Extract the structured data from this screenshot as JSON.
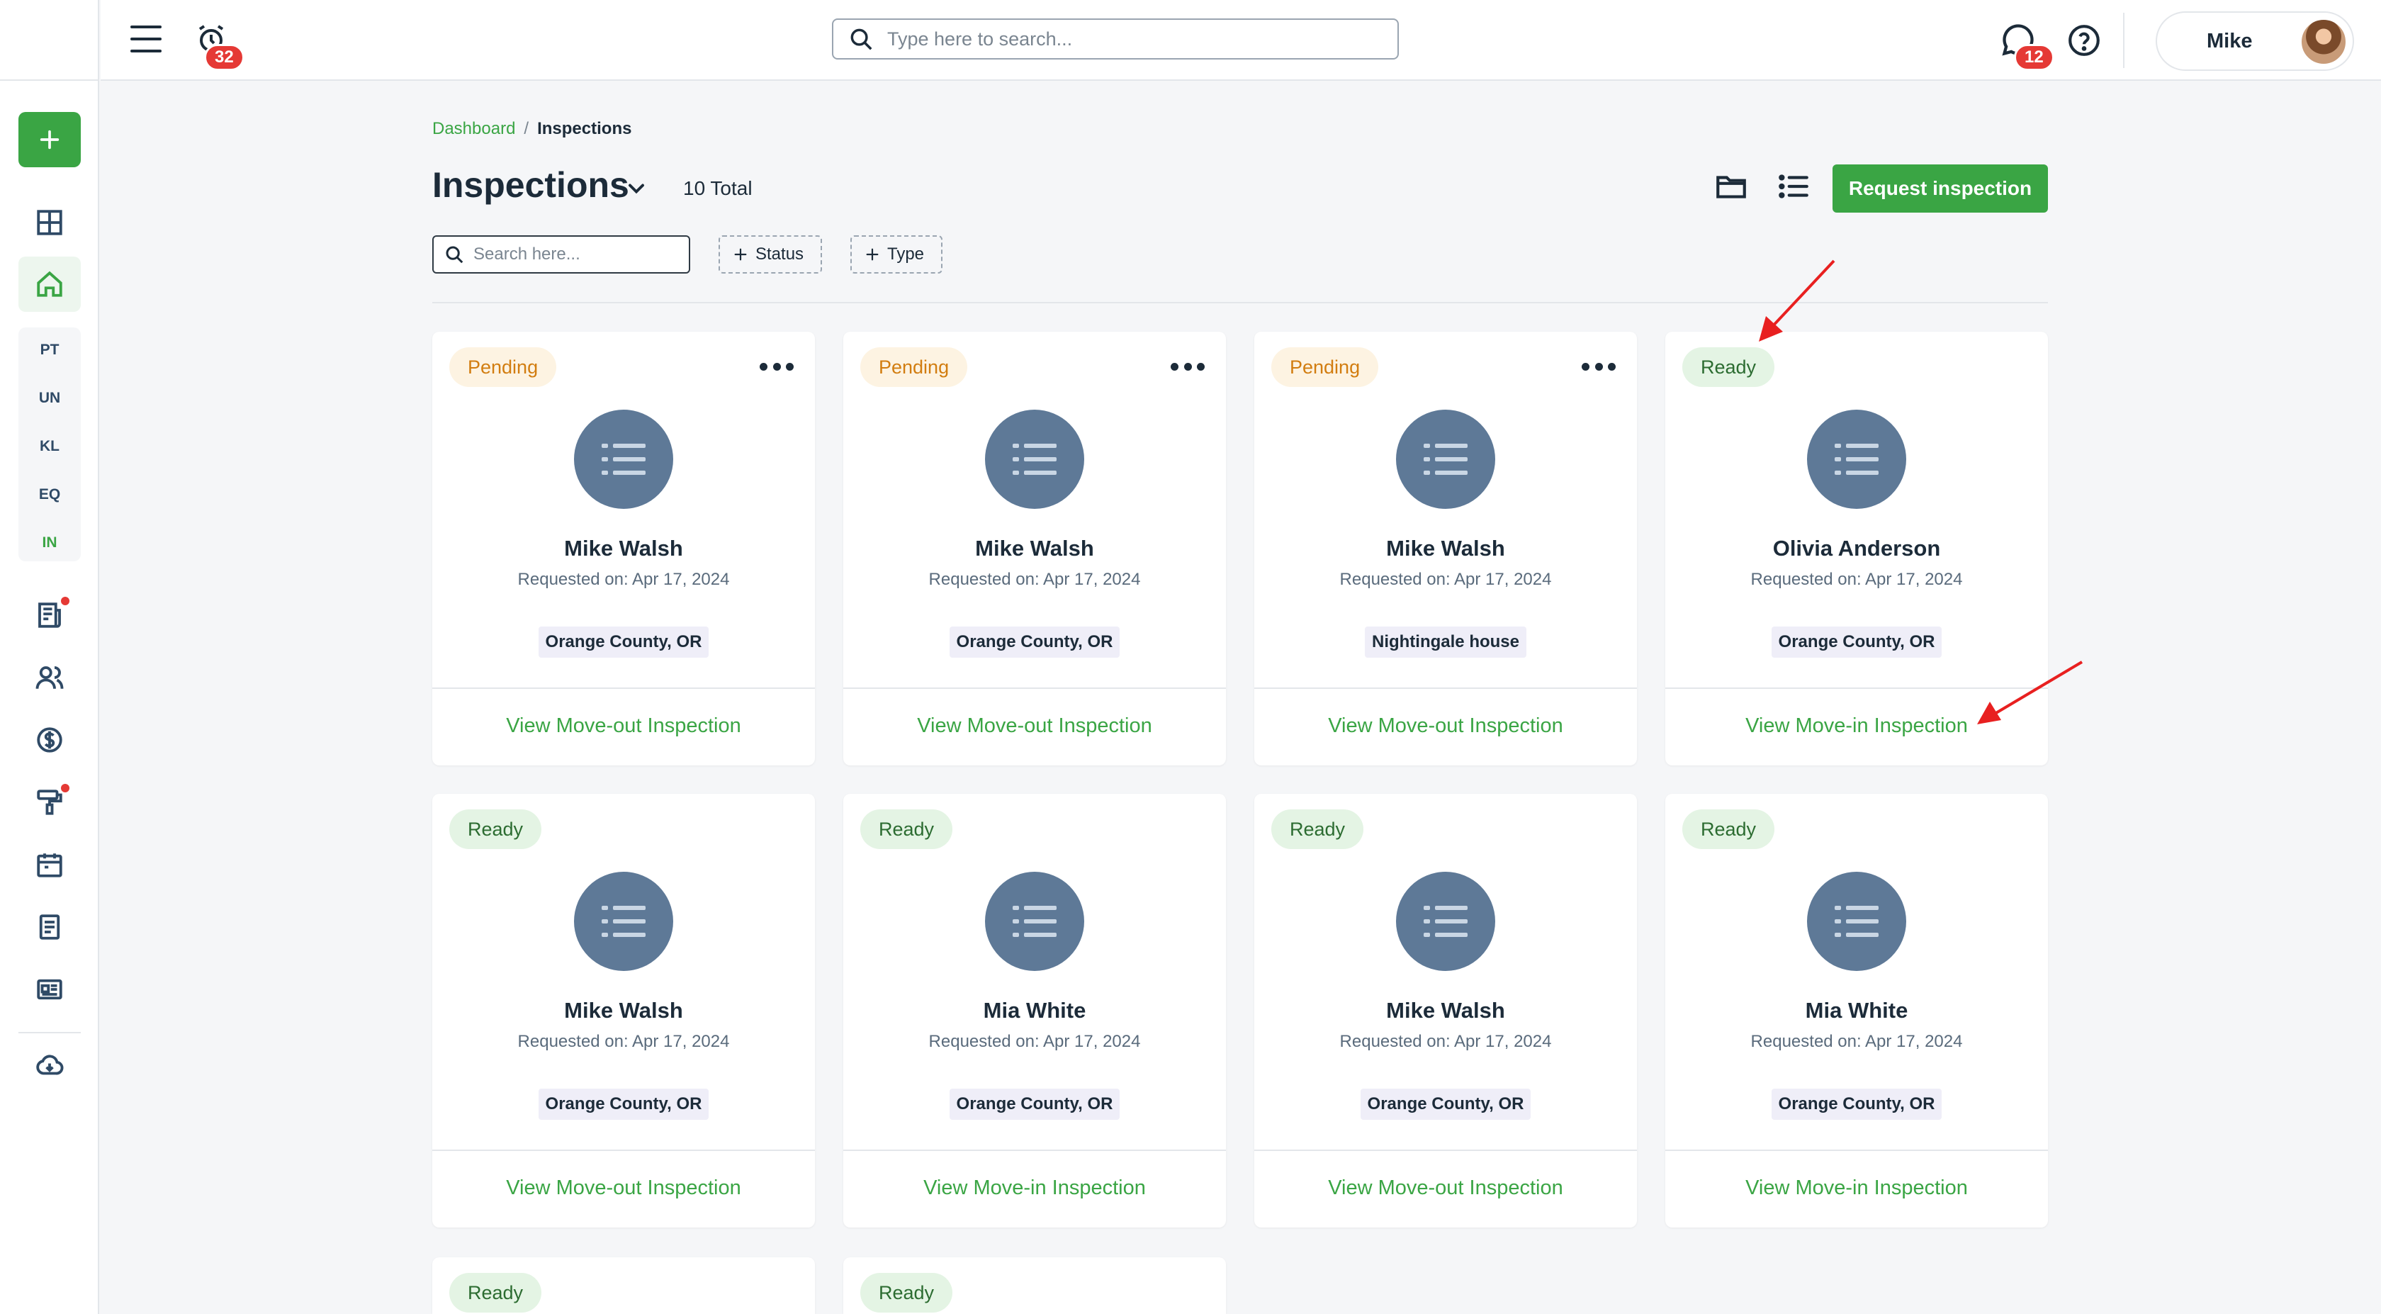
{
  "topbar": {
    "notifications_count": "32",
    "search_placeholder": "Type here to search...",
    "messages_count": "12",
    "user_name": "Mike"
  },
  "sidebar": {
    "sub_items": [
      "PT",
      "UN",
      "KL",
      "EQ",
      "IN"
    ],
    "active_sub_item": "IN"
  },
  "breadcrumb": {
    "root": "Dashboard",
    "separator": "/",
    "current": "Inspections"
  },
  "header": {
    "title": "Inspections",
    "total": "10 Total",
    "request_button": "Request inspection"
  },
  "filters": {
    "search_placeholder": "Search here...",
    "status_label": "Status",
    "type_label": "Type"
  },
  "colors": {
    "accent": "#3aa544",
    "pending_bg": "#fdf3e2",
    "pending_text": "#d27d10",
    "ready_bg": "#e4f4e4",
    "ready_text": "#2c6c31",
    "doc_circle": "#5e7997",
    "annotation_arrow": "#e82020"
  },
  "date_label": "Requested on:",
  "cards": [
    {
      "status": "Pending",
      "name": "Mike Walsh",
      "date": "Apr 17, 2024",
      "location": "Orange County, OR",
      "link": "View Move-out Inspection",
      "has_menu": true
    },
    {
      "status": "Pending",
      "name": "Mike Walsh",
      "date": "Apr 17, 2024",
      "location": "Orange County, OR",
      "link": "View Move-out Inspection",
      "has_menu": true
    },
    {
      "status": "Pending",
      "name": "Mike Walsh",
      "date": "Apr 17, 2024",
      "location": "Nightingale house",
      "link": "View Move-out Inspection",
      "has_menu": true
    },
    {
      "status": "Ready",
      "name": "Olivia Anderson",
      "date": "Apr 17, 2024",
      "location": "Orange County, OR",
      "link": "View Move-in Inspection",
      "has_menu": false
    },
    {
      "status": "Ready",
      "name": "Mike Walsh",
      "date": "Apr 17, 2024",
      "location": "Orange County, OR",
      "link": "View Move-out Inspection",
      "has_menu": false
    },
    {
      "status": "Ready",
      "name": "Mia White",
      "date": "Apr 17, 2024",
      "location": "Orange County, OR",
      "link": "View Move-in Inspection",
      "has_menu": false
    },
    {
      "status": "Ready",
      "name": "Mike Walsh",
      "date": "Apr 17, 2024",
      "location": "Orange County, OR",
      "link": "View Move-out Inspection",
      "has_menu": false
    },
    {
      "status": "Ready",
      "name": "Mia White",
      "date": "Apr 17, 2024",
      "location": "Orange County, OR",
      "link": "View Move-in Inspection",
      "has_menu": false
    },
    {
      "status": "Ready"
    },
    {
      "status": "Ready"
    }
  ]
}
